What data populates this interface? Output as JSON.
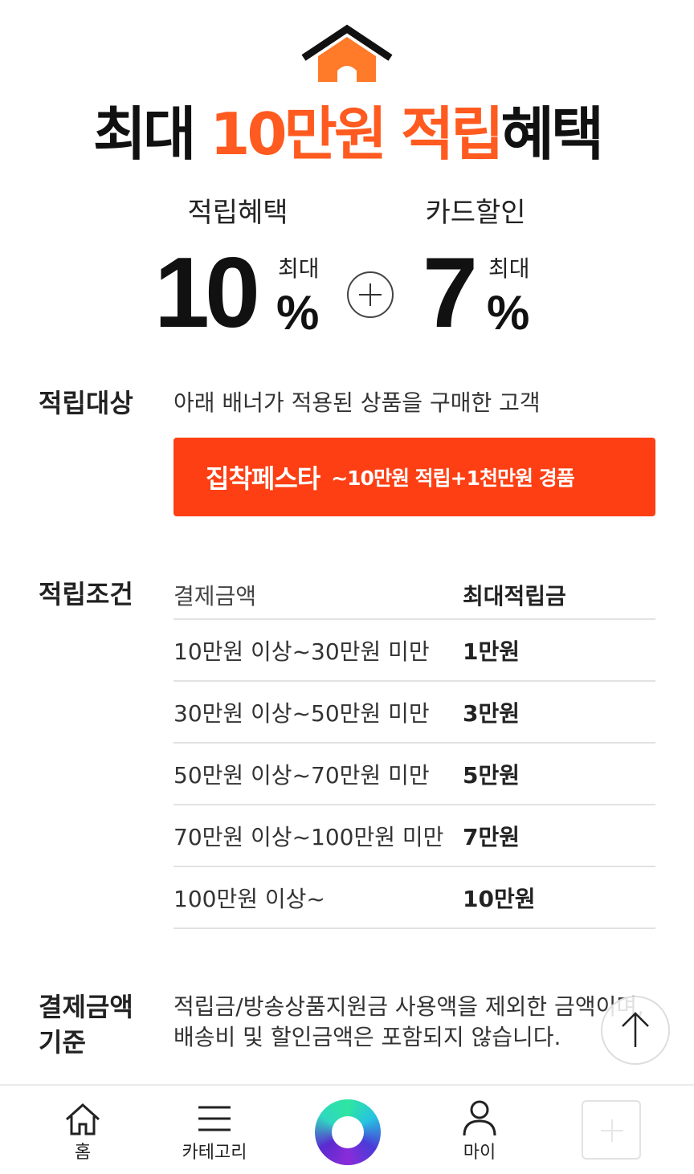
{
  "hero": {
    "title_prefix": "최대 ",
    "title_accent": "10만원 적립",
    "title_suffix": "혜택"
  },
  "benefits": {
    "left": {
      "label": "적립혜택",
      "value": "10",
      "small": "최대",
      "unit": "%"
    },
    "right": {
      "label": "카드할인",
      "value": "7",
      "small": "최대",
      "unit": "%"
    }
  },
  "target": {
    "title": "적립대상",
    "text": "아래 배너가 적용된 상품을 구매한 고객"
  },
  "banner": {
    "title": "집착페스타",
    "subtitle": "~10만원 적립+1천만원 경품"
  },
  "conditions": {
    "title": "적립조건",
    "headers": {
      "amount": "결제금액",
      "max": "최대적립금"
    },
    "rows": [
      {
        "amount": "10만원 이상~30만원 미만",
        "max": "1만원"
      },
      {
        "amount": "30만원 이상~50만원 미만",
        "max": "3만원"
      },
      {
        "amount": "50만원 이상~70만원 미만",
        "max": "5만원"
      },
      {
        "amount": "70만원 이상~100만원 미만",
        "max": "7만원"
      },
      {
        "amount": "100만원 이상~",
        "max": "10만원"
      }
    ]
  },
  "basis": {
    "title_line1": "결제금액",
    "title_line2": "기준",
    "line1": "적립금/방송상품지원금 사용액을 제외한 금액이며,",
    "line2": "배송비 및 할인금액은 포함되지 않습니다."
  },
  "scroll_top": {
    "icon": "arrow-up-icon"
  },
  "nav": {
    "home": "홈",
    "category": "카테고리",
    "my": "마이"
  },
  "colors": {
    "accent": "#ff5a1f",
    "banner": "#fd3f13"
  }
}
